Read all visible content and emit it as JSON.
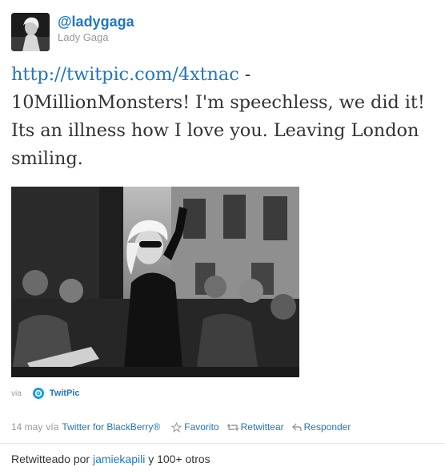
{
  "tweet": {
    "username": "@ladygaga",
    "fullname": "Lady Gaga",
    "link": "http://twitpic.com/4xtnac",
    "text_rest": " - 10MillionMonsters! I'm speechless, we did it! Its an illness how I love you. Leaving London smiling.",
    "photo_icon": "photo-crowd-image"
  },
  "via": {
    "label": "via",
    "service": "TwitPic",
    "icon": "twitpic-logo-icon"
  },
  "meta": {
    "date": "14 may",
    "via_word": "vía",
    "client": "Twitter for BlackBerry®",
    "favorite": "Favorito",
    "retweet": "Retwittear",
    "reply": "Responder",
    "favorite_icon": "star-icon",
    "retweet_icon": "retweet-icon",
    "reply_icon": "reply-icon"
  },
  "retweets": {
    "prefix": "Retwitteado por",
    "user": "jamiekapili",
    "suffix": "y 100+ otros"
  },
  "colors": {
    "link": "#2276bb",
    "muted": "#999999",
    "text": "#333333",
    "twitpic": "#1d9bd6"
  }
}
